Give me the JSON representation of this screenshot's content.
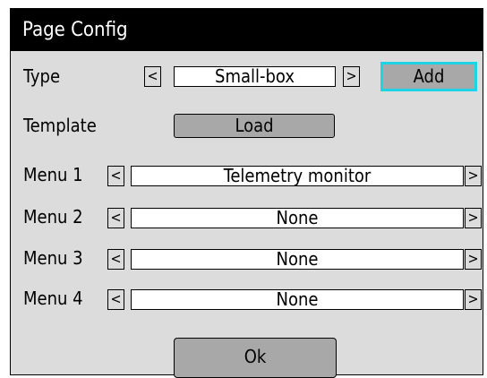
{
  "window": {
    "title": "Page Config"
  },
  "type_row": {
    "label": "Type",
    "value": "Small-box",
    "prev_icon": "<",
    "next_icon": ">",
    "add_label": "Add"
  },
  "template_row": {
    "label": "Template",
    "load_label": "Load"
  },
  "menus": [
    {
      "label": "Menu 1",
      "value": "Telemetry monitor",
      "prev_icon": "<",
      "next_icon": ">"
    },
    {
      "label": "Menu 2",
      "value": "None",
      "prev_icon": "<",
      "next_icon": ">"
    },
    {
      "label": "Menu 3",
      "value": "None",
      "prev_icon": "<",
      "next_icon": ">"
    },
    {
      "label": "Menu 4",
      "value": "None",
      "prev_icon": "<",
      "next_icon": ">"
    }
  ],
  "ok_label": "Ok",
  "colors": {
    "titlebar": "#000000",
    "panel": "#dcdcdc",
    "button": "#a8a8a8",
    "add_border": "#1fd3e6"
  }
}
